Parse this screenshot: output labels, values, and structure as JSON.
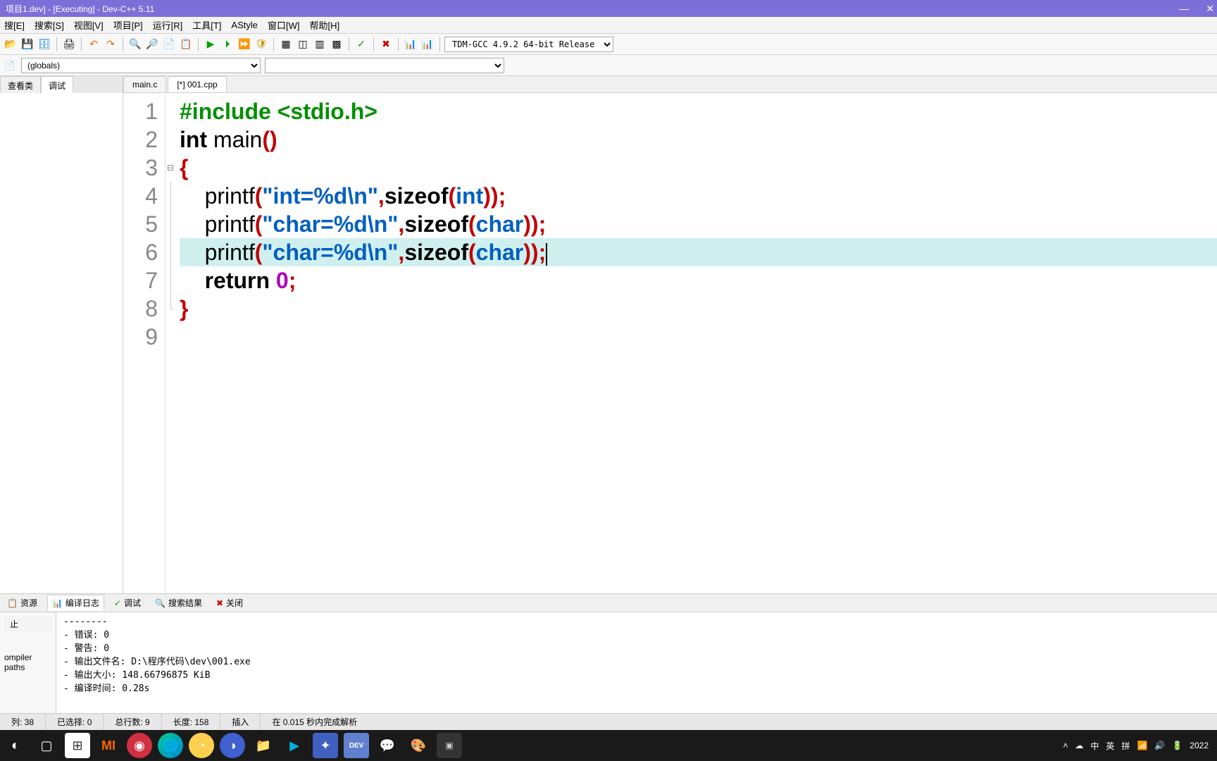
{
  "window": {
    "title": "项目1.dev] - [Executing] - Dev-C++ 5.11"
  },
  "menu": {
    "items": [
      "搜[E]",
      "搜索[S]",
      "视图[V]",
      "项目[P]",
      "运行[R]",
      "工具[T]",
      "AStyle",
      "窗口[W]",
      "帮助[H]"
    ]
  },
  "toolbar": {
    "compiler_select": "TDM-GCC 4.9.2 64-bit Release"
  },
  "scope_selector": {
    "value": "(globals)"
  },
  "side_tabs": [
    "查看类",
    "调试"
  ],
  "editor_tabs": [
    {
      "label": "main.c",
      "active": false
    },
    {
      "label": "[*] 001.cpp",
      "active": true
    }
  ],
  "code": {
    "lines": [
      {
        "n": 1,
        "type": "preproc",
        "text": "#include <stdio.h>"
      },
      {
        "n": 2,
        "type": "decl",
        "parts": [
          "int",
          " main",
          "(",
          ")"
        ]
      },
      {
        "n": 3,
        "type": "brace_open",
        "text": "{"
      },
      {
        "n": 4,
        "type": "printf",
        "str": "\"int=%d\\n\"",
        "size_kw": "sizeof",
        "size_arg": "int"
      },
      {
        "n": 5,
        "type": "printf",
        "str": "\"char=%d\\n\"",
        "size_kw": "sizeof",
        "size_arg": "char"
      },
      {
        "n": 6,
        "type": "printf",
        "str": "\"char=%d\\n\"",
        "size_kw": "sizeof",
        "size_arg": "char",
        "highlight": true,
        "caret": true
      },
      {
        "n": 7,
        "type": "return",
        "kw": "return",
        "val": "0"
      },
      {
        "n": 8,
        "type": "brace_close",
        "text": "}"
      },
      {
        "n": 9,
        "type": "empty"
      }
    ]
  },
  "bottom_tabs": [
    "资源",
    "编译日志",
    "调试",
    "搜索结果",
    "关闭"
  ],
  "bottom_tabs_active_index": 1,
  "compile_log": {
    "stop_button": "止",
    "paths_label": "ompiler paths",
    "lines": [
      "--------",
      "- 错误: 0",
      "- 警告: 0",
      "- 输出文件名: D:\\程序代码\\dev\\001.exe",
      "- 输出大小: 148.66796875 KiB",
      "- 编译时间: 0.28s"
    ]
  },
  "status": {
    "col": "列:  38",
    "selected": "已选择:   0",
    "total_lines": "总行数:   9",
    "length": "长度:  158",
    "insert": "插入",
    "parse": "在 0.015 秒内完成解析"
  },
  "tray": {
    "ime": [
      "中",
      "英",
      "拼"
    ],
    "year": "2022"
  }
}
